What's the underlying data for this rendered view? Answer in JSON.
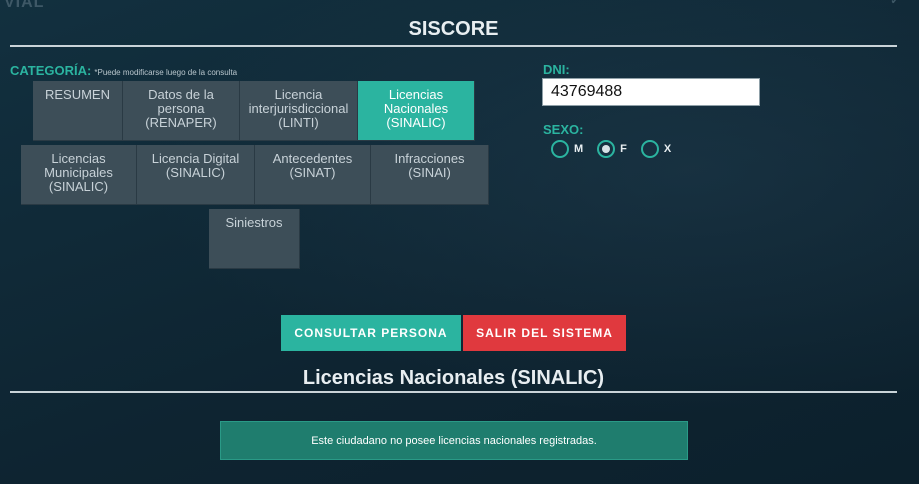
{
  "header": {
    "partial_brand": "VIAL",
    "title": "SISCORE"
  },
  "categoria": {
    "label": "CATEGORÍA:",
    "note": "*Puede modificarse luego de la consulta",
    "tabs": [
      {
        "label": "RESUMEN",
        "active": false
      },
      {
        "label": "Datos de la persona (RENAPER)",
        "active": false
      },
      {
        "label": "Licencia interjurisdiccional (LINTI)",
        "active": false
      },
      {
        "label": "Licencias Nacionales (SINALIC)",
        "active": true
      },
      {
        "label": "Licencias Municipales (SINALIC)",
        "active": false
      },
      {
        "label": "Licencia Digital (SINALIC)",
        "active": false
      },
      {
        "label": "Antecedentes (SINAT)",
        "active": false
      },
      {
        "label": "Infracciones (SINAI)",
        "active": false
      },
      {
        "label": "Siniestros",
        "active": false
      }
    ]
  },
  "form": {
    "dni_label": "DNI:",
    "dni_value": "43769488",
    "sexo_label": "SEXO:",
    "sexo_options": [
      {
        "label": "M",
        "checked": false
      },
      {
        "label": "F",
        "checked": true
      },
      {
        "label": "X",
        "checked": false
      }
    ]
  },
  "actions": {
    "consultar": "CONSULTAR PERSONA",
    "salir": "SALIR DEL SISTEMA"
  },
  "result": {
    "section_title": "Licencias Nacionales (SINALIC)",
    "message": "Este ciudadano no posee licencias nacionales registradas."
  },
  "colors": {
    "accent": "#2bb4a0",
    "danger": "#e0393e",
    "background": "#0f2634",
    "tab": "#3d4e58"
  }
}
